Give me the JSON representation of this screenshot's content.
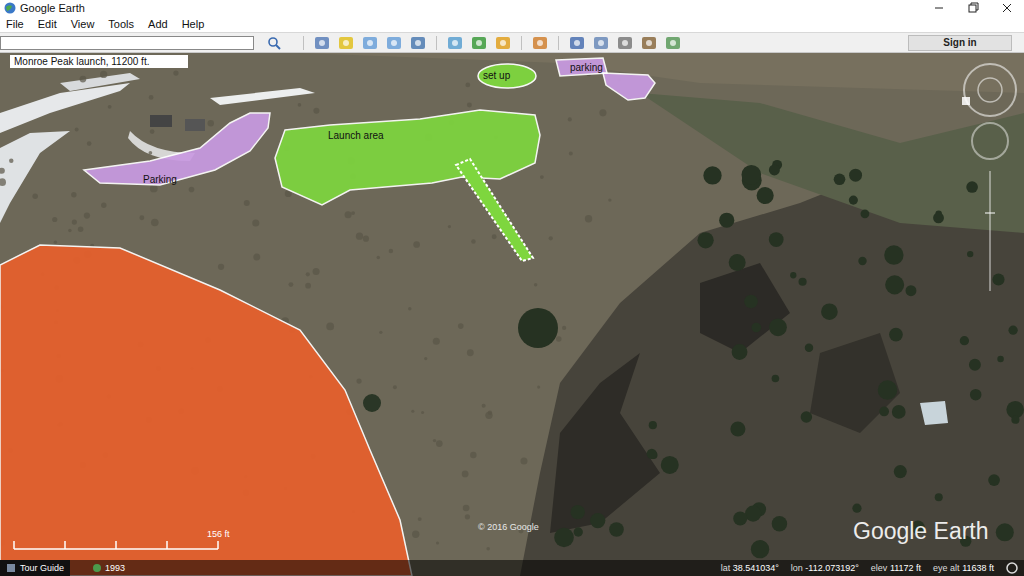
{
  "window": {
    "title": "Google Earth"
  },
  "menu": [
    "File",
    "Edit",
    "View",
    "Tools",
    "Add",
    "Help"
  ],
  "search": {
    "value": ""
  },
  "sign_in": "Sign in",
  "placemark": {
    "label": "Monroe Peak launch, 11200 ft."
  },
  "overlays": [
    {
      "label": "set up",
      "color": "#7ed63e"
    },
    {
      "label": "Launch area",
      "color": "#7ed63e"
    },
    {
      "label": "parking",
      "color": "#c99ae2"
    },
    {
      "label": "Parking",
      "color": "#c99ae2"
    },
    {
      "label": "",
      "color": "#e8602c"
    }
  ],
  "scale": "156 ft",
  "copyright": "© 2016 Google",
  "logo": "Google Earth",
  "status_bar": {
    "tour_guide": "Tour Guide",
    "year": "1993",
    "readouts": [
      {
        "label": "lat",
        "value": "38.541034°"
      },
      {
        "label": "lon",
        "value": "-112.073192°"
      },
      {
        "label": "elev",
        "value": "11172 ft"
      },
      {
        "label": "eye alt",
        "value": "11638 ft"
      }
    ]
  }
}
